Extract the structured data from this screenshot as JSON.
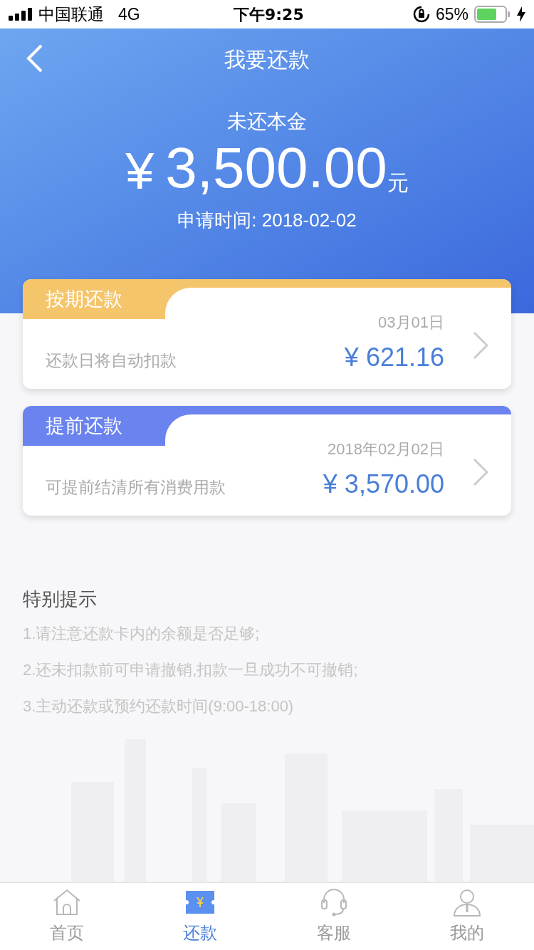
{
  "status_bar": {
    "carrier": "中国联通",
    "network": "4G",
    "time": "下午9:25",
    "battery": "65%"
  },
  "header": {
    "title": "我要还款",
    "label": "未还本金",
    "currency": "¥",
    "amount": "3,500.00",
    "unit": "元",
    "apply_date": "申请时间: 2018-02-02"
  },
  "plans": [
    {
      "tag": "按期还款",
      "color": "#f5c56b",
      "date": "03月01日",
      "description": "还款日将自动扣款",
      "amount": "¥ 621.16"
    },
    {
      "tag": "提前还款",
      "color": "#6a83ee",
      "date": "2018年02月02日",
      "description": "可提前结清所有消费用款",
      "amount": "¥ 3,570.00"
    }
  ],
  "tips": {
    "title": "特别提示",
    "items": [
      "1.请注意还款卡内的余额是否足够;",
      "2.还未扣款前可申请撤销,扣款一旦成功不可撤销;",
      "3.主动还款或预约还款时间(9:00-18:00)"
    ]
  },
  "tab_bar": [
    {
      "kind": "home",
      "label": "首页",
      "selected": false
    },
    {
      "kind": "repay",
      "label": "还款",
      "selected": true
    },
    {
      "kind": "service",
      "label": "客服",
      "selected": false
    },
    {
      "kind": "me",
      "label": "我的",
      "selected": false
    }
  ]
}
